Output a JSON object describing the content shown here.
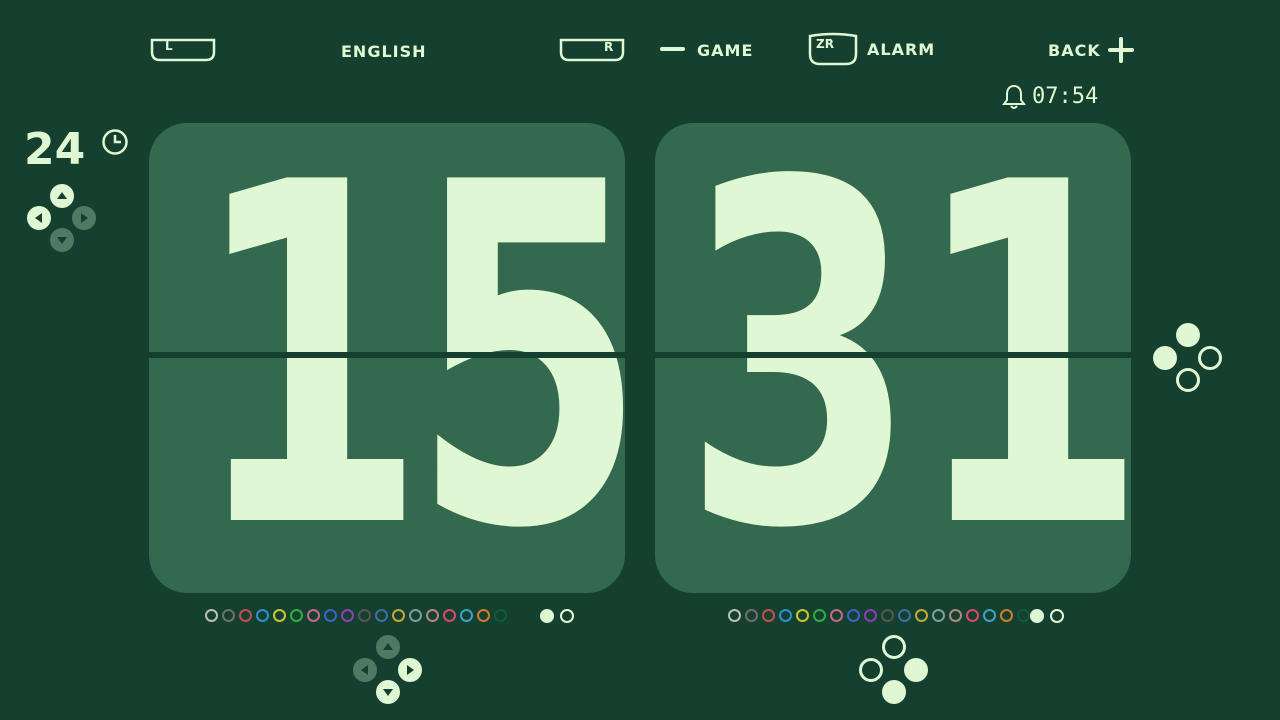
{
  "topbar": {
    "l_key": "L",
    "language": "ENGLISH",
    "r_key": "R",
    "game_label": "GAME",
    "zr_key": "ZR",
    "alarm_label": "ALARM",
    "back_label": "BACK"
  },
  "alarm_time": "07:54",
  "format": "24",
  "clock": {
    "hour_digits": [
      "1",
      "5"
    ],
    "minute_digits": [
      "3",
      "1"
    ]
  },
  "palette_left": {
    "colors": [
      "#bdbdbd",
      "#6f6f6f",
      "#c0504d",
      "#2e8fcf",
      "#c9c632",
      "#2fae3e",
      "#c56a8d",
      "#3d63c7",
      "#8b3fb6",
      "#555555",
      "#3f6ea0",
      "#c4a73a",
      "#7a9f9d",
      "#b08a80",
      "#d94a6a",
      "#3fa1c9",
      "#d47a2d",
      "#0e5a3a"
    ],
    "selected": [
      "#e0f7d3"
    ],
    "unselected": [
      "#e0f7d3"
    ]
  },
  "palette_right": {
    "colors": [
      "#bdbdbd",
      "#6f6f6f",
      "#c0504d",
      "#2e8fcf",
      "#c9c632",
      "#2fae3e",
      "#c56a8d",
      "#3d63c7",
      "#8b3fb6",
      "#555555",
      "#3f6ea0",
      "#c4a73a",
      "#7a9f9d",
      "#b08a80",
      "#d94a6a",
      "#3fa1c9",
      "#d47a2d",
      "#0e5a3a"
    ],
    "selected": [
      "#e0f7d3"
    ],
    "unselected": [
      "#e0f7d3"
    ]
  },
  "colors": {
    "background": "#153f2f",
    "card": "#33694f",
    "foreground": "#e0f7d3"
  }
}
